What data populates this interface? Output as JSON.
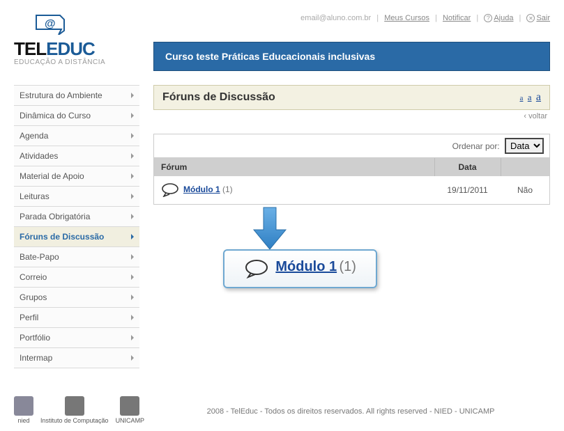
{
  "top": {
    "email": "email@aluno.com.br",
    "my_courses": "Meus Cursos",
    "notify": "Notificar",
    "help": "Ajuda",
    "exit": "Sair"
  },
  "brand": {
    "part1": "TEL",
    "part2": "EDUC",
    "sub": "EDUCAÇÃO A DISTÂNCIA"
  },
  "course_title": "Curso teste Práticas Educacionais inclusivas",
  "sidebar": {
    "items": [
      {
        "label": "Estrutura do Ambiente"
      },
      {
        "label": "Dinâmica do Curso"
      },
      {
        "label": "Agenda"
      },
      {
        "label": "Atividades"
      },
      {
        "label": "Material de Apoio"
      },
      {
        "label": "Leituras"
      },
      {
        "label": "Parada Obrigatória"
      },
      {
        "label": "Fóruns de Discussão",
        "active": true
      },
      {
        "label": "Bate-Papo"
      },
      {
        "label": "Correio"
      },
      {
        "label": "Grupos"
      },
      {
        "label": "Perfil"
      },
      {
        "label": "Portfólio"
      },
      {
        "label": "Intermap"
      }
    ]
  },
  "page": {
    "title": "Fóruns de Discussão",
    "font_a": "a",
    "back": "‹ voltar"
  },
  "sort": {
    "label": "Ordenar por:",
    "selected": "Data",
    "options": [
      "Data"
    ]
  },
  "table": {
    "col_forum": "Fórum",
    "col_data": "Data",
    "col_nova": "",
    "rows": [
      {
        "name": "Módulo 1",
        "count": "(1)",
        "date": "19/11/2011",
        "nova": "Não"
      }
    ]
  },
  "zoom": {
    "name": "Módulo 1",
    "count": "(1)"
  },
  "footer": {
    "logos": [
      {
        "id": "nied",
        "label": "nied"
      },
      {
        "id": "ic",
        "label": "Instituto de\nComputação"
      },
      {
        "id": "unicamp",
        "label": "UNICAMP"
      }
    ],
    "copy": "2008 - TelEduc - Todos os direitos reservados. All rights reserved - NIED - UNICAMP"
  }
}
